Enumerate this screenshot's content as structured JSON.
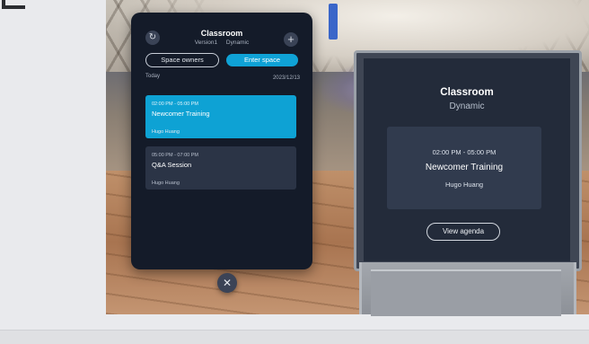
{
  "panel": {
    "title": "Classroom",
    "version": "Version1",
    "mode": "Dynamic",
    "space_owners_label": "Space owners",
    "enter_space_label": "Enter space",
    "day_label": "Today",
    "date": "2023/12/13",
    "refresh_icon": "refresh-icon",
    "add_icon": "plus-icon",
    "events": [
      {
        "time": "02:00 PM - 05:00 PM",
        "name": "Newcomer Training",
        "owner": "Hugo Huang",
        "selected": true
      },
      {
        "time": "05:00 PM - 07:00 PM",
        "name": "Q&A Session",
        "owner": "Hugo Huang",
        "selected": false
      }
    ]
  },
  "close_icon": "close-icon",
  "board": {
    "title": "Classroom",
    "mode": "Dynamic",
    "event_time": "02:00 PM - 05:00 PM",
    "event_name": "Newcomer Training",
    "event_owner": "Hugo Huang",
    "agenda_label": "View agenda"
  },
  "colors": {
    "accent": "#0ea2d4",
    "panel_bg": "#141b29",
    "card_bg": "#2b3446"
  }
}
